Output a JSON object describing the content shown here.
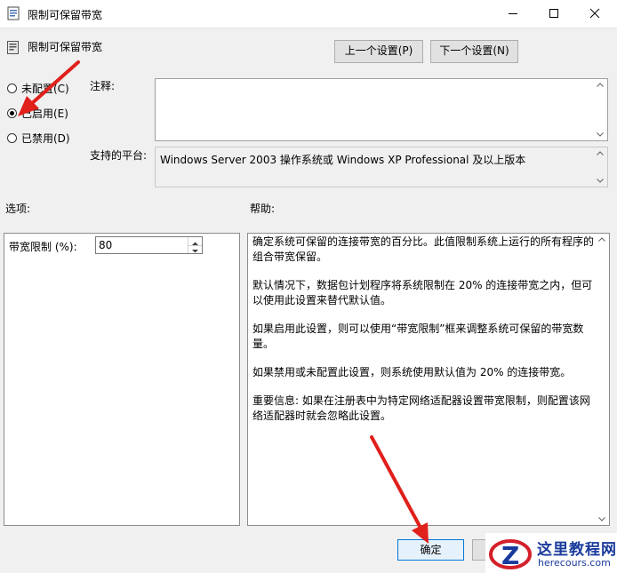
{
  "window": {
    "title": "限制可保留带宽",
    "controls": [
      "minimize-icon",
      "maximize-icon",
      "close-icon"
    ]
  },
  "header": {
    "policy_title": "限制可保留带宽",
    "prev_button": "上一个设置(P)",
    "next_button": "下一个设置(N)"
  },
  "state": {
    "radios": [
      {
        "label": "未配置(C)",
        "selected": false
      },
      {
        "label": "已启用(E)",
        "selected": true
      },
      {
        "label": "已禁用(D)",
        "selected": false
      }
    ]
  },
  "fields": {
    "comment_label": "注释:",
    "comment_value": "",
    "platform_label": "支持的平台:",
    "platform_value": "Windows Server 2003 操作系统或 Windows XP Professional 及以上版本"
  },
  "options": {
    "section_label": "选项:",
    "bandwidth_label": "带宽限制 (%):",
    "bandwidth_value": "80"
  },
  "help": {
    "section_label": "帮助:",
    "paragraphs": [
      "确定系统可保留的连接带宽的百分比。此值限制系统上运行的所有程序的组合带宽保留。",
      "默认情况下，数据包计划程序将系统限制在 20% 的连接带宽之内，但可以使用此设置来替代默认值。",
      "如果启用此设置，则可以使用“带宽限制”框来调整系统可保留的带宽数量。",
      "如果禁用或未配置此设置，则系统使用默认值为 20% 的连接带宽。",
      "重要信息: 如果在注册表中为特定网络适配器设置带宽限制，则配置该网络适配器时就会忽略此设置。"
    ]
  },
  "footer": {
    "ok_button": "确定"
  },
  "watermark": {
    "title": "这里教程网",
    "url": "herecours.com"
  },
  "colors": {
    "annotation_arrow": "#e0201b",
    "ok_border": "#0078d7",
    "watermark_blue": "#1a3a9c"
  }
}
